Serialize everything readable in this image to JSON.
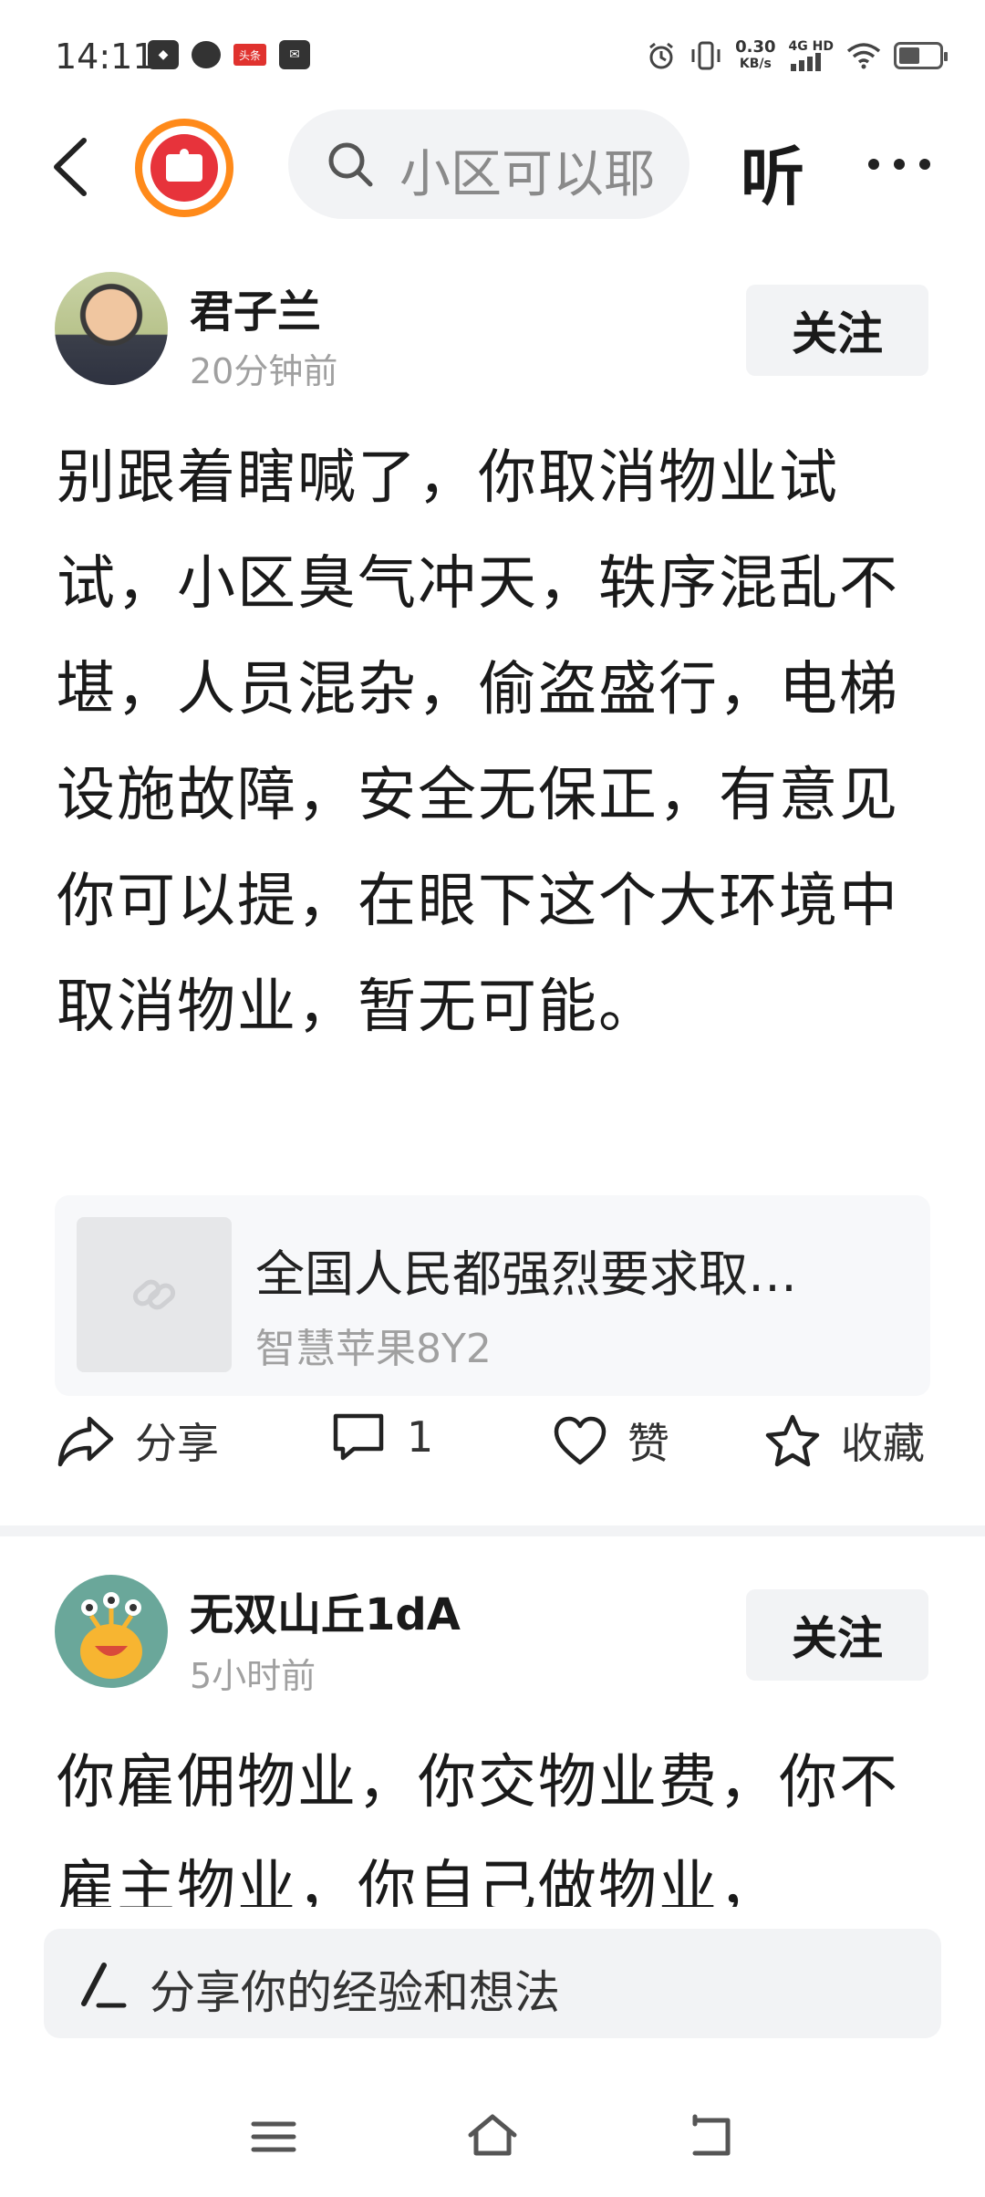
{
  "status_bar": {
    "time": "14:11",
    "icons_left": [
      "app-notification-icon",
      "chat-bubble-icon",
      "toutiao-icon",
      "message-icon"
    ],
    "toutiao_label": "头条",
    "net_speed_value": "0.30",
    "net_speed_unit": "KB/s",
    "network": "4G HD",
    "icons_right": [
      "alarm-icon",
      "vibrate-icon",
      "signal-icon",
      "wifi-icon",
      "battery-icon"
    ]
  },
  "nav": {
    "back_icon": "chevron-left-icon",
    "search_placeholder": "小区可以耶",
    "listen_label": "听",
    "more_icon": "more-icon"
  },
  "posts": [
    {
      "username": "君子兰",
      "time": "20分钟前",
      "follow_label": "关注",
      "content": "别跟着瞎喊了，你取消物业试试，小区臭气冲天，轶序混乱不堪，人员混杂，偷盗盛行，电梯设施故障，安全无保正，有意见你可以提，在眼下这个大环境中取消物业，暂无可能。",
      "link_card": {
        "title": "全国人民都强烈要求取…",
        "subtitle": "智慧苹果8Y2"
      },
      "actions": {
        "share": "分享",
        "comment_count": "1",
        "like": "赞",
        "favorite": "收藏"
      }
    },
    {
      "username": "无双山丘1dA",
      "time": "5小时前",
      "follow_label": "关注",
      "content": "你雇佣物业，你交物业费，你不雇主物业，你自己做物业，"
    }
  ],
  "comment_bar": {
    "placeholder": "分享你的经验和想法"
  },
  "system_nav": {
    "buttons": [
      "menu-icon",
      "home-icon",
      "back-icon"
    ]
  }
}
